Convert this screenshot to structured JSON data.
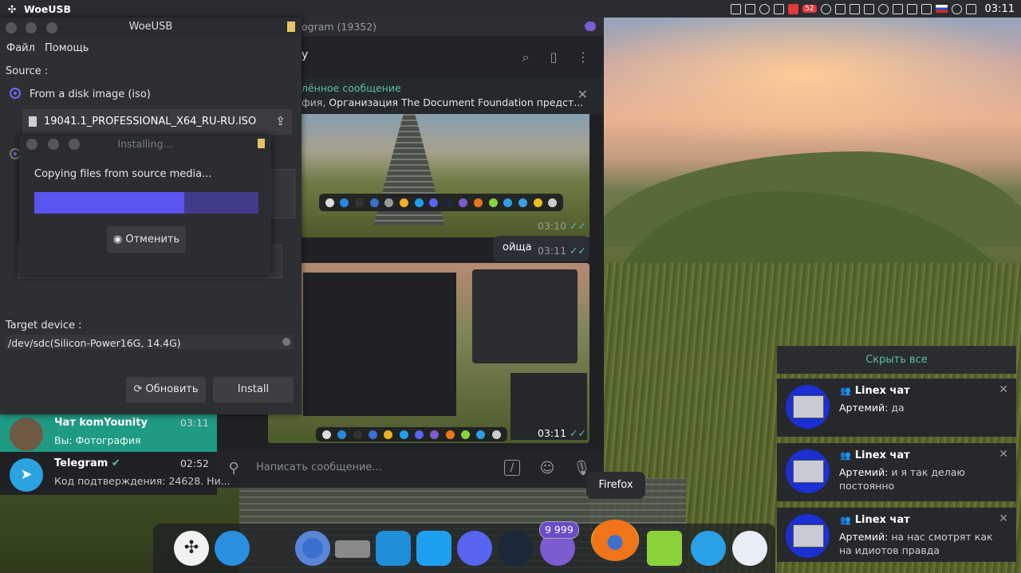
{
  "top_panel": {
    "app_title": "WoeUSB",
    "badge": "52",
    "clock": "03:11"
  },
  "telegram": {
    "window_title": "ogram (19352)",
    "chat_name": "y",
    "pinned": {
      "title": "лённое сообщение",
      "sender": "фия,",
      "text": "Организация The Document Foundation предст..."
    },
    "messages": [
      {
        "time": "03:10"
      },
      {
        "text": "ойща",
        "time": "03:11"
      },
      {
        "time": "03:11"
      }
    ],
    "compose_placeholder": "Написать сообщение...",
    "chats": [
      {
        "name": "Чат komYounity",
        "time": "03:11",
        "preview": "Вы: Фотография"
      },
      {
        "name": "Telegram",
        "time": "02:52",
        "preview": "Код подтверждения: 24628. Ни..."
      }
    ]
  },
  "woeusb": {
    "title": "WoeUSB",
    "menu": [
      "Файл",
      "Помощь"
    ],
    "source_label": "Source :",
    "option_iso": "From a disk image (iso)",
    "iso_file": "19041.1_PROFESSIONAL_X64_RU-RU.ISO",
    "target_label": "Target device :",
    "target_device": "/dev/sdc(Silicon-Power16G, 14.4G)",
    "refresh_label": "Обновить",
    "install_label": "Install"
  },
  "installing": {
    "title": "Installing...",
    "message": "Copying files from source media...",
    "progress_percent": 67,
    "cancel_label": "Отменить"
  },
  "notifications": {
    "hide_all": "Скрыть все",
    "items": [
      {
        "title": "Linex чат",
        "author": "Артемий:",
        "text": "да"
      },
      {
        "title": "Linex чат",
        "author": "Артемий:",
        "text": "и я так делаю постоянно"
      },
      {
        "title": "Linex чат",
        "author": "Артемий:",
        "text": "на нас смотрят как на идиотов правда"
      }
    ]
  },
  "dock": {
    "tooltip": "Firefox",
    "telegram_badge": "9 999"
  },
  "colors": {
    "accent": "#5a54f0",
    "telegram_green": "#1f9a83",
    "link": "#5ec0a8"
  }
}
